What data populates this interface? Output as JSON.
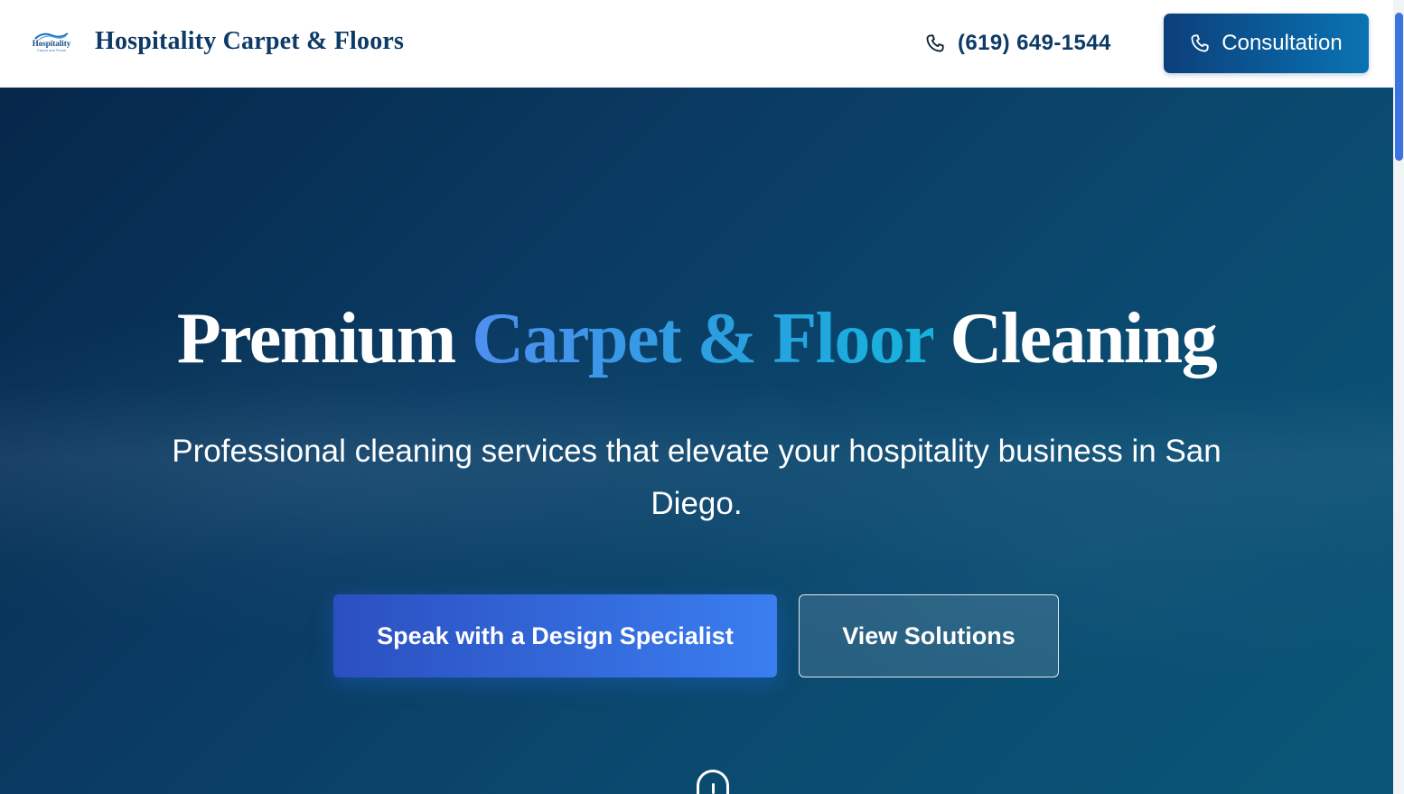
{
  "header": {
    "logo": {
      "word": "Hospitality",
      "sub": "Carpet and Floors"
    },
    "brand_name": "Hospitality Carpet & Floors",
    "phone_icon": "phone-icon",
    "phone": "(619) 649-1544",
    "consult_label": "Consultation"
  },
  "hero": {
    "title_part1": "Premium ",
    "title_accent": "Carpet & Floor",
    "title_part2": " Cleaning",
    "subtitle": "Professional cleaning services that elevate your hospitality business in San Diego.",
    "primary_cta": "Speak with a Design Specialist",
    "secondary_cta": "View Solutions",
    "scroll_icon": "mouse-scroll-icon"
  },
  "colors": {
    "brand_navy": "#0d3a66",
    "accent_blue": "#3a7ef0",
    "accent_cyan": "#16b3dc",
    "hero_bg": "#0a3a62",
    "scrollbar_thumb": "#3b73e0"
  }
}
